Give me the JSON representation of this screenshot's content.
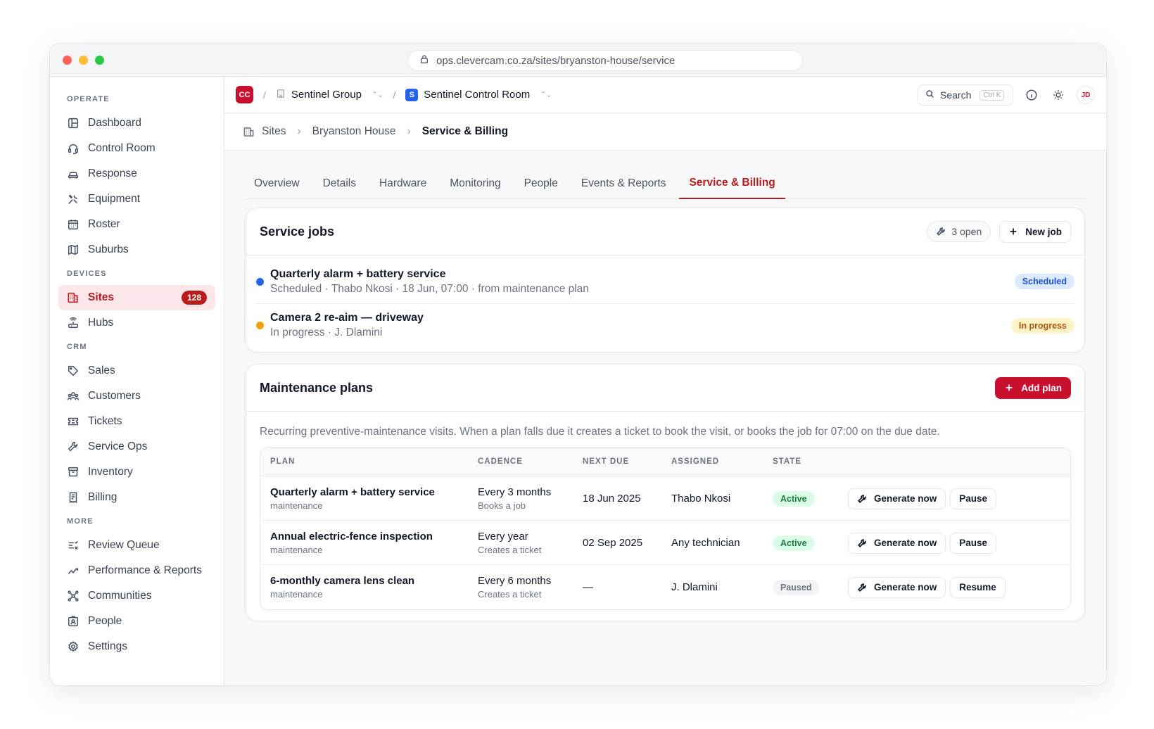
{
  "browser": {
    "url": "ops.clevercam.co.za/sites/bryanston-house/service"
  },
  "sidebar": {
    "sections": [
      {
        "label": "OPERATE",
        "items": [
          {
            "label": "Dashboard",
            "icon": "dashboard-icon"
          },
          {
            "label": "Control Room",
            "icon": "headset-icon"
          },
          {
            "label": "Response",
            "icon": "car-icon"
          },
          {
            "label": "Equipment",
            "icon": "tools-icon"
          },
          {
            "label": "Roster",
            "icon": "calendar-icon"
          },
          {
            "label": "Suburbs",
            "icon": "map-icon"
          }
        ]
      },
      {
        "label": "DEVICES",
        "items": [
          {
            "label": "Sites",
            "icon": "building-icon",
            "badge": "128",
            "active": true
          },
          {
            "label": "Hubs",
            "icon": "router-icon"
          }
        ]
      },
      {
        "label": "CRM",
        "items": [
          {
            "label": "Sales",
            "icon": "tag-icon"
          },
          {
            "label": "Customers",
            "icon": "users-icon"
          },
          {
            "label": "Tickets",
            "icon": "ticket-icon"
          },
          {
            "label": "Service Ops",
            "icon": "wrench-icon"
          },
          {
            "label": "Inventory",
            "icon": "archive-icon"
          },
          {
            "label": "Billing",
            "icon": "receipt-icon"
          }
        ]
      },
      {
        "label": "MORE",
        "items": [
          {
            "label": "Review Queue",
            "icon": "list-check-icon"
          },
          {
            "label": "Performance & Reports",
            "icon": "trend-icon"
          },
          {
            "label": "Communities",
            "icon": "network-icon"
          },
          {
            "label": "People",
            "icon": "id-badge-icon"
          },
          {
            "label": "Settings",
            "icon": "gear-icon"
          }
        ]
      }
    ]
  },
  "topbar": {
    "org_badge": "CC",
    "group": "Sentinel Group",
    "room_badge": "S",
    "room": "Sentinel Control Room",
    "search_label": "Search",
    "search_kbd": "Ctrl K",
    "avatar": "JD"
  },
  "breadcrumb": {
    "root": "Sites",
    "site": "Bryanston House",
    "current": "Service & Billing"
  },
  "tabs": [
    "Overview",
    "Details",
    "Hardware",
    "Monitoring",
    "People",
    "Events & Reports",
    "Service & Billing"
  ],
  "service_jobs": {
    "title": "Service jobs",
    "open_count": "3 open",
    "new_job_label": "New job",
    "jobs": [
      {
        "title": "Quarterly alarm + battery service",
        "sub": "Scheduled · Thabo Nkosi · 18 Jun, 07:00 · from maintenance plan",
        "status": "Scheduled",
        "dot_color": "#2563eb",
        "pill_bg": "#dbeafe",
        "pill_fg": "#1d4ed8"
      },
      {
        "title": "Camera 2 re-aim — driveway",
        "sub": "In progress · J. Dlamini",
        "status": "In progress",
        "dot_color": "#f59e0b",
        "pill_bg": "#fef3c7",
        "pill_fg": "#b45309"
      }
    ]
  },
  "maintenance": {
    "title": "Maintenance plans",
    "add_label": "Add plan",
    "description": "Recurring preventive-maintenance visits. When a plan falls due it creates a ticket to book the visit, or books the job for 07:00 on the due date.",
    "columns": [
      "PLAN",
      "CADENCE",
      "NEXT DUE",
      "ASSIGNED",
      "STATE"
    ],
    "rows": [
      {
        "plan": "Quarterly alarm + battery service",
        "type": "maintenance",
        "cadence": "Every 3 months",
        "cadence_sub": "Books a job",
        "next_due": "18 Jun 2025",
        "assigned": "Thabo Nkosi",
        "state": "Active",
        "generate": "Generate now",
        "toggle": "Pause"
      },
      {
        "plan": "Annual electric-fence inspection",
        "type": "maintenance",
        "cadence": "Every year",
        "cadence_sub": "Creates a ticket",
        "next_due": "02 Sep 2025",
        "assigned": "Any technician",
        "state": "Active",
        "generate": "Generate now",
        "toggle": "Pause"
      },
      {
        "plan": "6-monthly camera lens clean",
        "type": "maintenance",
        "cadence": "Every 6 months",
        "cadence_sub": "Creates a ticket",
        "next_due": "—",
        "assigned": "J. Dlamini",
        "state": "Paused",
        "generate": "Generate now",
        "toggle": "Resume"
      }
    ]
  },
  "colors": {
    "brand": "#c8102e",
    "active_tab": "#b91c1c"
  }
}
